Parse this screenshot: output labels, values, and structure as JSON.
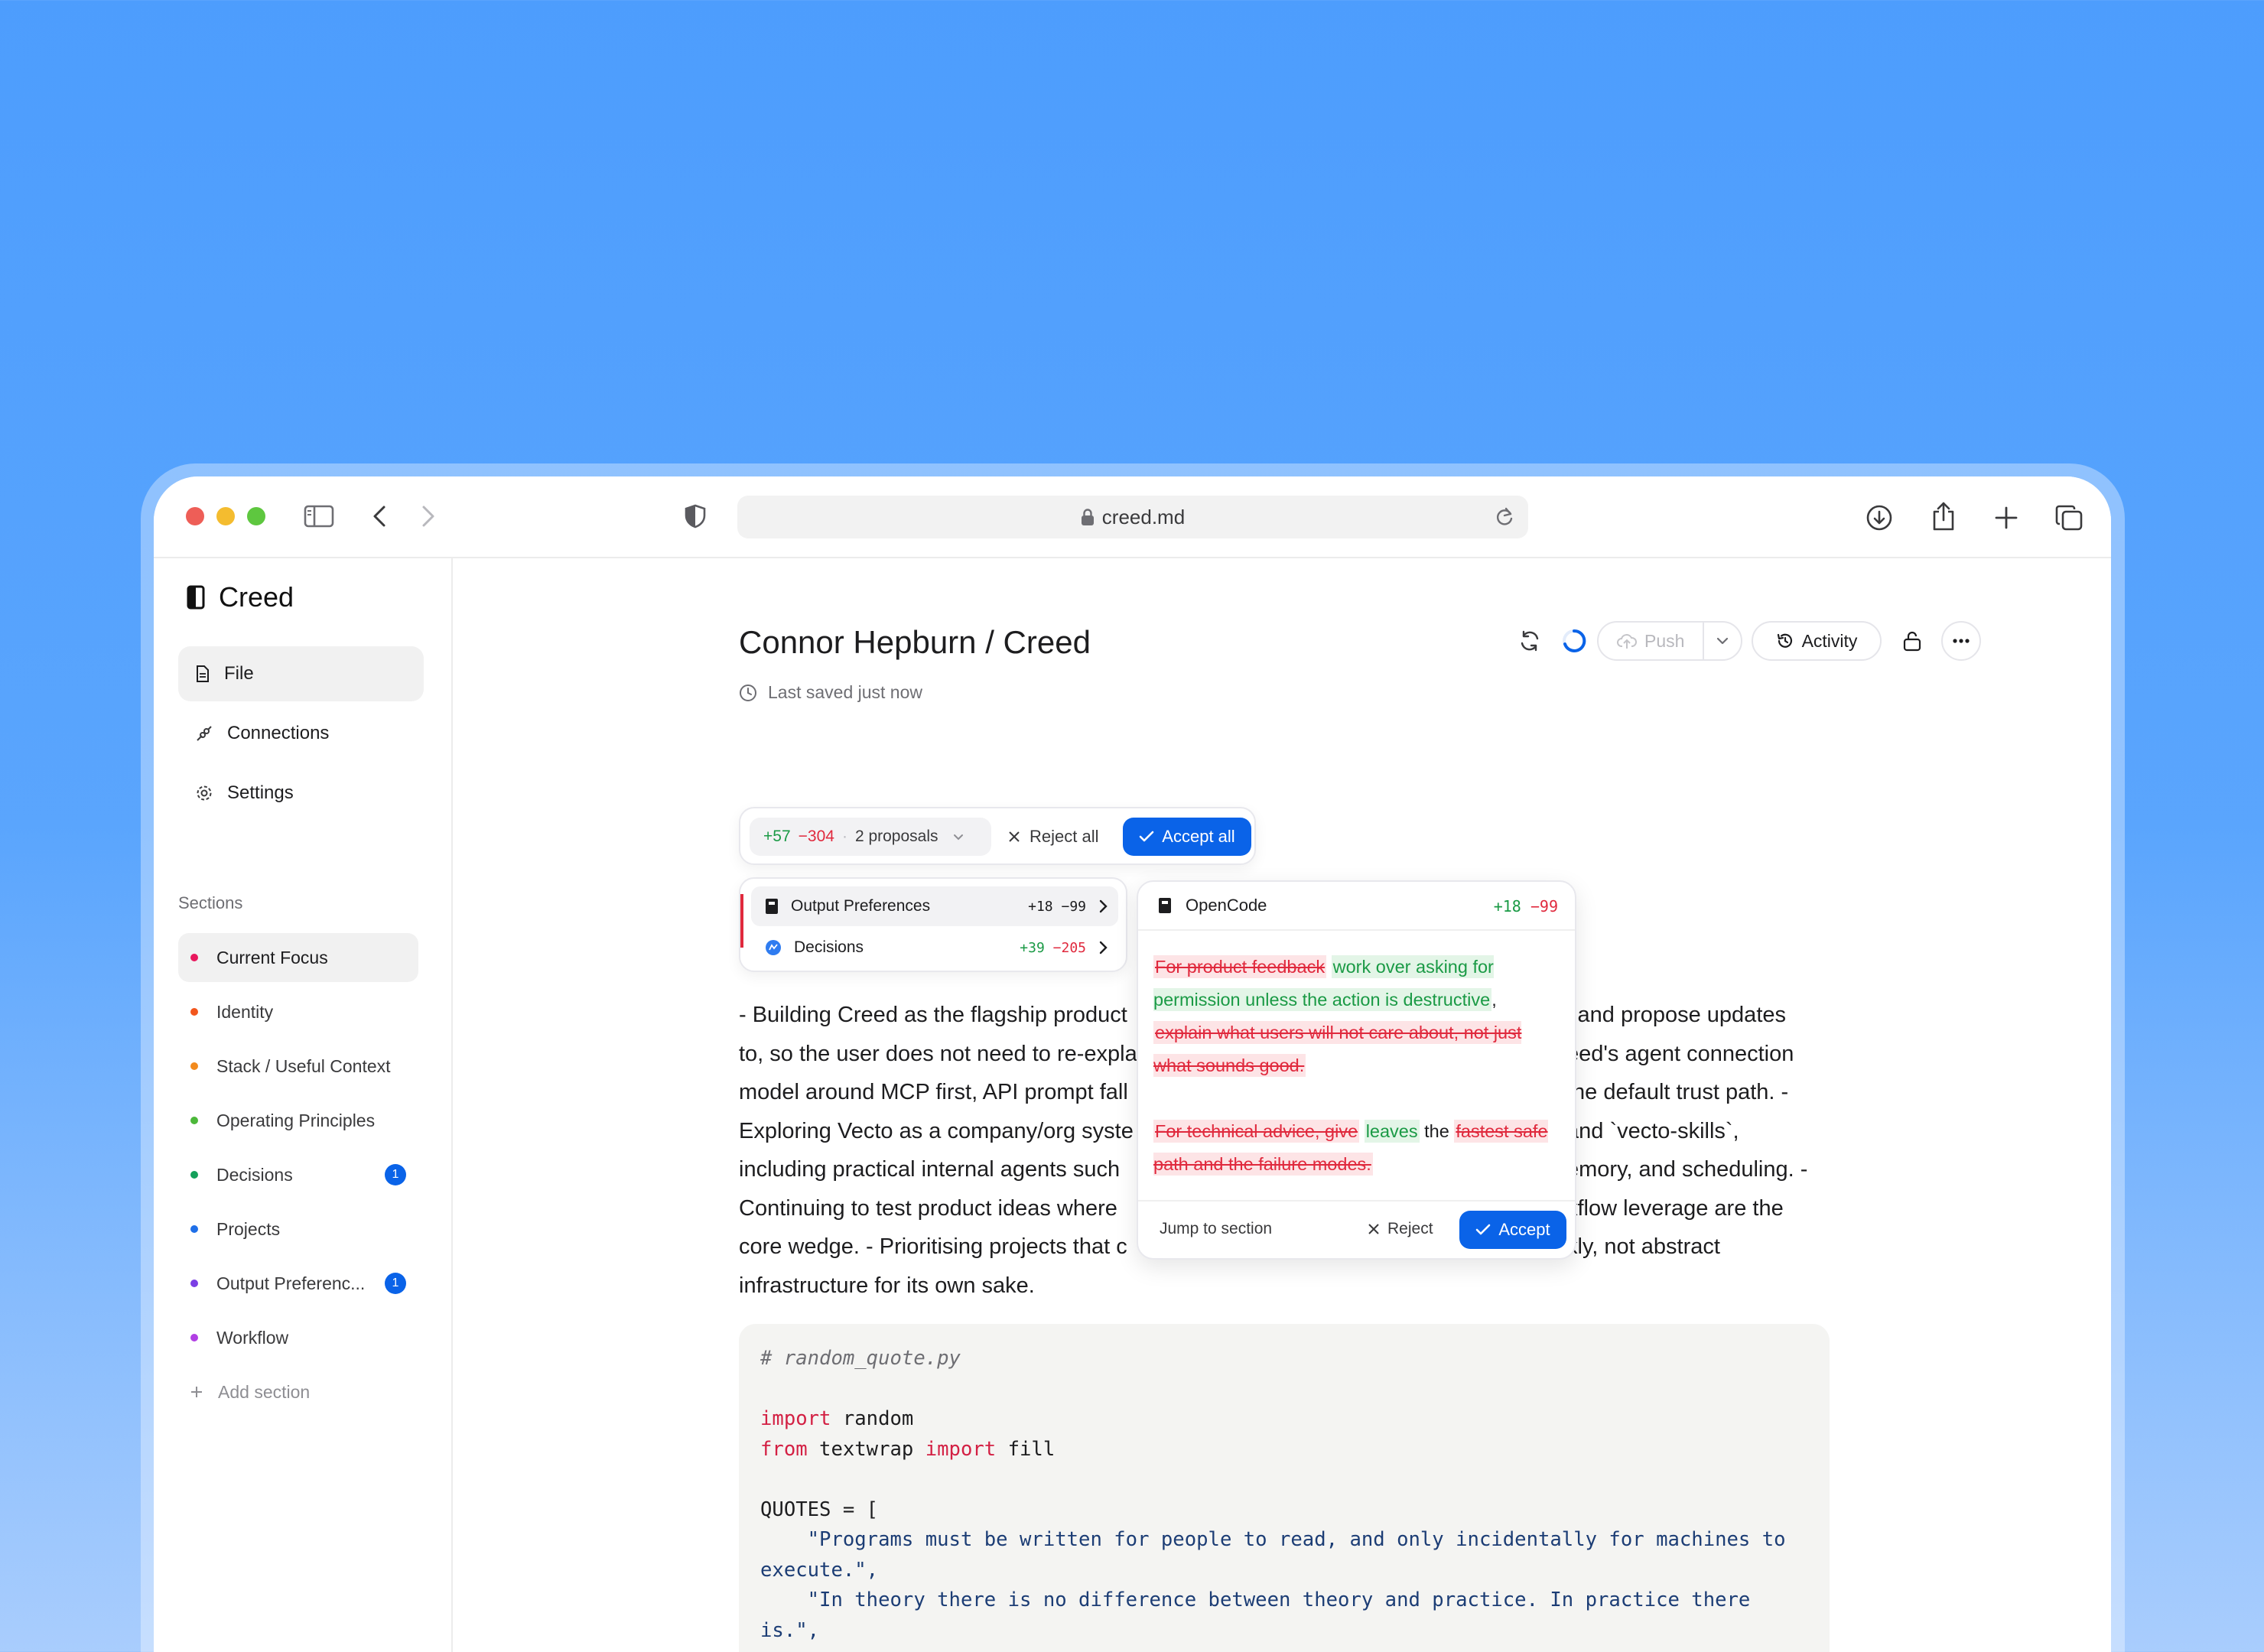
{
  "browser": {
    "url": "creed.md"
  },
  "sidebar": {
    "brand": "Creed",
    "nav": [
      {
        "label": "File"
      },
      {
        "label": "Connections"
      },
      {
        "label": "Settings"
      }
    ],
    "sections_title": "Sections",
    "sections": [
      {
        "label": "Current Focus",
        "color": "#e8175d",
        "badge": ""
      },
      {
        "label": "Identity",
        "color": "#f2561d",
        "badge": ""
      },
      {
        "label": "Stack / Useful Context",
        "color": "#f28a1d",
        "badge": ""
      },
      {
        "label": "Operating Principles",
        "color": "#4cb83a",
        "badge": ""
      },
      {
        "label": "Decisions",
        "color": "#14a05a",
        "badge": "1"
      },
      {
        "label": "Projects",
        "color": "#1f6fe8",
        "badge": ""
      },
      {
        "label": "Output Preferenc...",
        "color": "#7b3fe4",
        "badge": "1"
      },
      {
        "label": "Workflow",
        "color": "#b13fe4",
        "badge": ""
      }
    ],
    "add_section": "Add section"
  },
  "header": {
    "title": "Connor Hepburn / Creed",
    "saved": "Last saved just now",
    "push": "Push",
    "activity": "Activity"
  },
  "proposals": {
    "added": "+57",
    "removed": "−304",
    "separator": "·",
    "count_label": "2 proposals",
    "reject_all": "Reject all",
    "accept_all": "Accept all",
    "items": [
      {
        "label": "Output Preferences",
        "added": "+18",
        "removed": "−99"
      },
      {
        "label": "Decisions",
        "added": "+39",
        "removed": "−205"
      }
    ]
  },
  "diff": {
    "source": "OpenCode",
    "added": "+18",
    "removed": "−99",
    "p1": {
      "del1": "For product feedback",
      "ins1": "work over asking for permission unless the action is destructive",
      "plain1": ",",
      "del2": "explain what users will not care about, not just what sounds good."
    },
    "p2": {
      "del1": "For technical advice, give",
      "ins1": "leaves",
      "plain1": "the",
      "del2": "fastest safe path and the failure modes."
    },
    "jump": "Jump to section",
    "reject": "Reject",
    "accept": "Accept"
  },
  "document": {
    "lines": [
      "- Building Creed as the flagship product",
      "to, so the user does not need to re-expla",
      "model around MCP first, API prompt fall",
      "Exploring Vecto as a company/org syste",
      "including practical internal agents such",
      "Continuing to test product ideas where",
      "core wedge. - Prioritising projects that c",
      "infrastructure for its own sake."
    ],
    "lines_right": [
      "l and propose updates",
      "eed's agent connection",
      "the default trust path. -",
      "and `vecto-skills`,",
      "emory, and scheduling. -",
      "kflow leverage are the",
      "kly, not abstract",
      ""
    ],
    "code": {
      "comment": "# random_quote.py",
      "kw_import": "import",
      "mod_random": " random",
      "kw_from": "from",
      "mod_textwrap": " textwrap ",
      "kw_import2": "import",
      "fn_fill": " fill",
      "quotes_open": "QUOTES = [",
      "q1": "    \"Programs must be written for people to read, and only incidentally for machines to execute.\",",
      "q2": "    \"In theory there is no difference between theory and practice. In practice there is.\","
    }
  },
  "colors": {
    "accent": "#0a63e8",
    "added": "#1a9a45",
    "removed": "#e0293d"
  }
}
